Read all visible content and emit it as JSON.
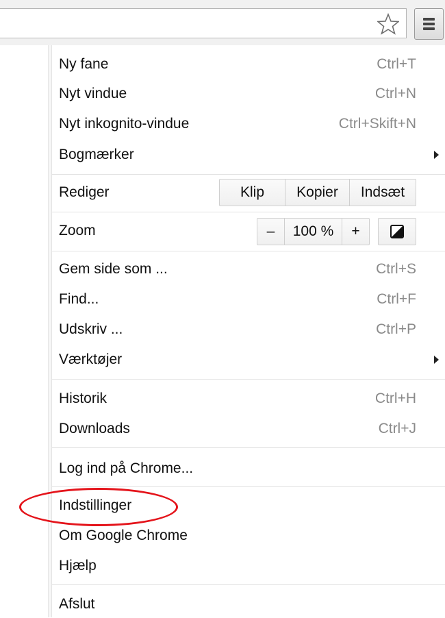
{
  "menu": {
    "new_tab": {
      "label": "Ny fane",
      "shortcut": "Ctrl+T"
    },
    "new_window": {
      "label": "Nyt vindue",
      "shortcut": "Ctrl+N"
    },
    "incognito": {
      "label": "Nyt inkognito-vindue",
      "shortcut": "Ctrl+Skift+N"
    },
    "bookmarks": {
      "label": "Bogmærker"
    },
    "edit": {
      "label": "Rediger",
      "cut": "Klip",
      "copy": "Kopier",
      "paste": "Indsæt"
    },
    "zoom": {
      "label": "Zoom",
      "minus": "–",
      "value": "100 %",
      "plus": "+"
    },
    "save_page": {
      "label": "Gem side som ...",
      "shortcut": "Ctrl+S"
    },
    "find": {
      "label": "Find...",
      "shortcut": "Ctrl+F"
    },
    "print": {
      "label": "Udskriv ...",
      "shortcut": "Ctrl+P"
    },
    "tools": {
      "label": "Værktøjer"
    },
    "history": {
      "label": "Historik",
      "shortcut": "Ctrl+H"
    },
    "downloads": {
      "label": "Downloads",
      "shortcut": "Ctrl+J"
    },
    "sign_in": {
      "label": "Log ind på Chrome..."
    },
    "settings": {
      "label": "Indstillinger"
    },
    "about": {
      "label": "Om Google Chrome"
    },
    "help": {
      "label": "Hjælp"
    },
    "exit": {
      "label": "Afslut"
    }
  },
  "icons": {
    "star": "star-outline-icon",
    "menu": "hamburger-menu-icon",
    "fullscreen": "fullscreen-icon",
    "submenu": "chevron-right-icon"
  },
  "colors": {
    "highlight_circle": "#e4141b",
    "shortcut_text": "#8a8a8a"
  }
}
